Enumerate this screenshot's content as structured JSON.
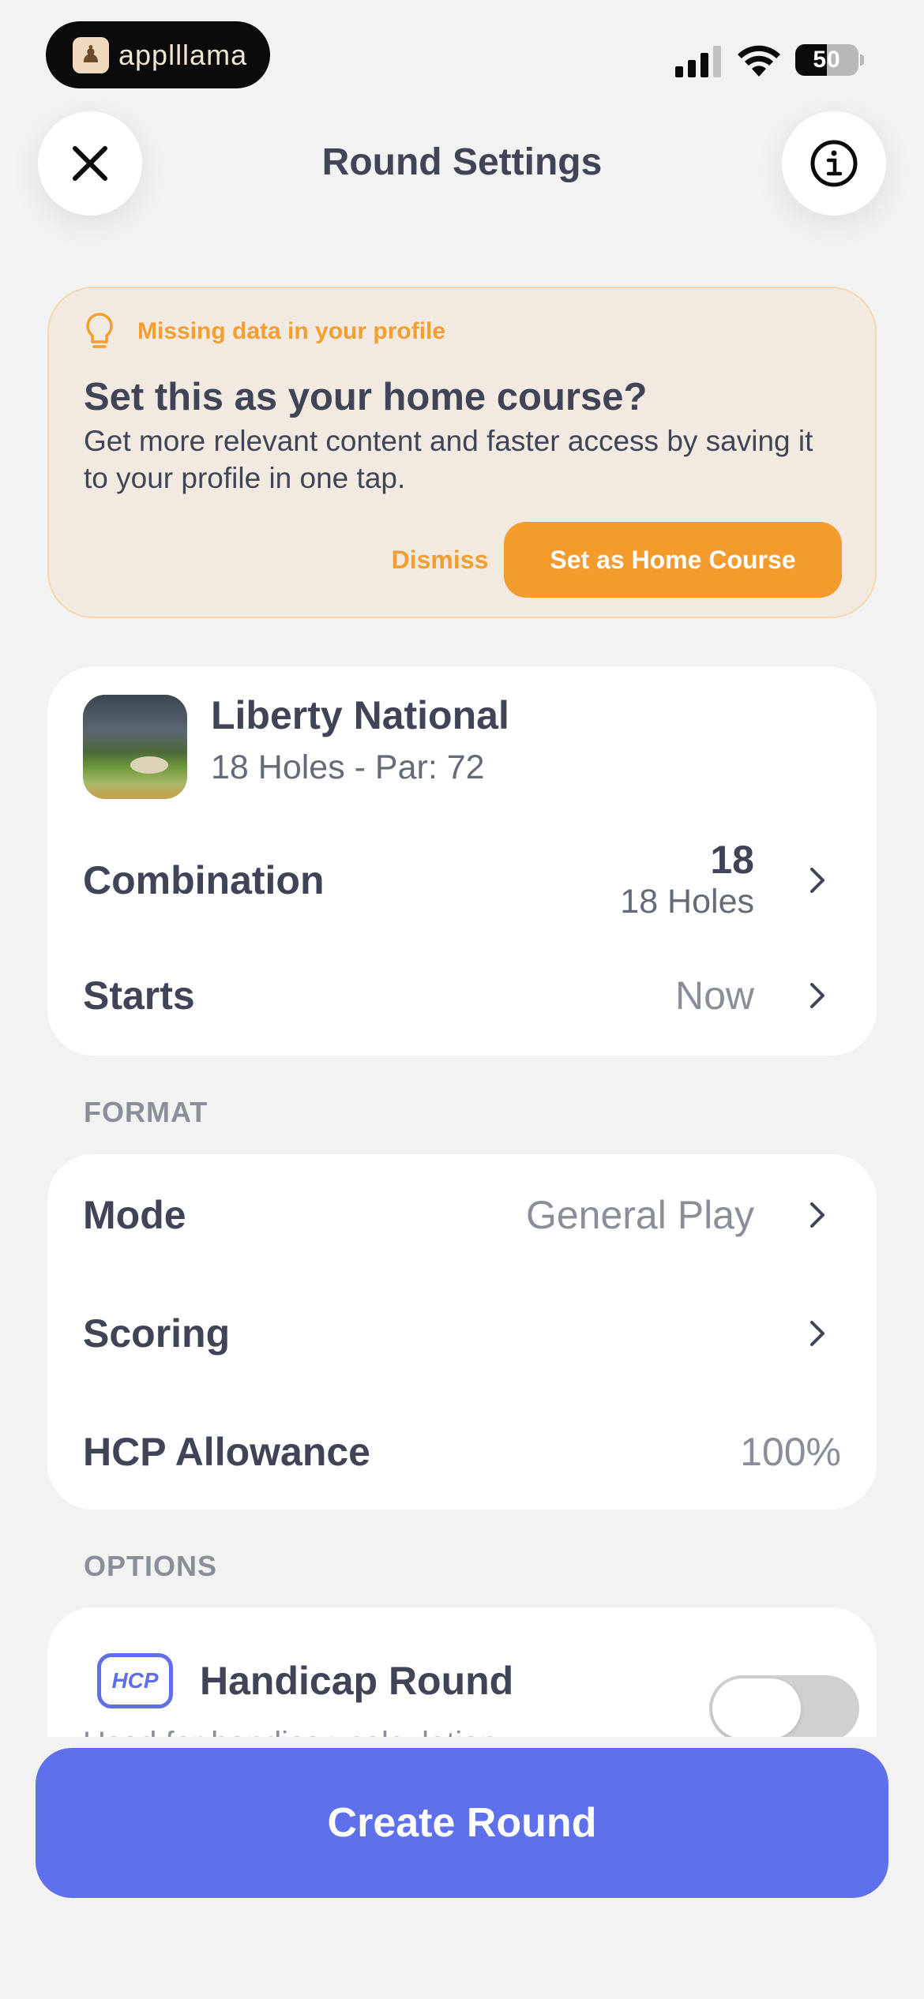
{
  "status_bar": {
    "app_badge_name": "applllama",
    "battery_percent": 50,
    "battery_label": "50"
  },
  "header": {
    "title": "Round Settings",
    "close_icon": "close-icon",
    "info_icon": "info-icon"
  },
  "home_banner": {
    "hint_icon": "lightbulb-icon",
    "hint": "Missing data in your profile",
    "headline": "Set this as your home course?",
    "body": "Get more relevant content and faster access by saving it to your profile in one tap.",
    "dismiss_label": "Dismiss",
    "set_home_label": "Set as Home Course",
    "accent_color": "#f49b2e"
  },
  "course": {
    "name": "Liberty National",
    "subtitle": "18 Holes - Par: 72",
    "combination_label": "Combination",
    "combination_value": "18",
    "combination_sub": "18 Holes",
    "starts_label": "Starts",
    "starts_value": "Now"
  },
  "format": {
    "section_title": "FORMAT",
    "mode_label": "Mode",
    "mode_value": "General Play",
    "scoring_label": "Scoring",
    "hcp_allowance_label": "HCP Allowance",
    "hcp_allowance_value": "100%"
  },
  "options": {
    "section_title": "OPTIONS",
    "hcp_badge": "HCP",
    "handicap_round_label": "Handicap Round",
    "handicap_round_enabled": false,
    "handicap_round_sub": "Used for handicap calculation"
  },
  "create_button": {
    "label": "Create Round",
    "color": "#5f70ec"
  }
}
